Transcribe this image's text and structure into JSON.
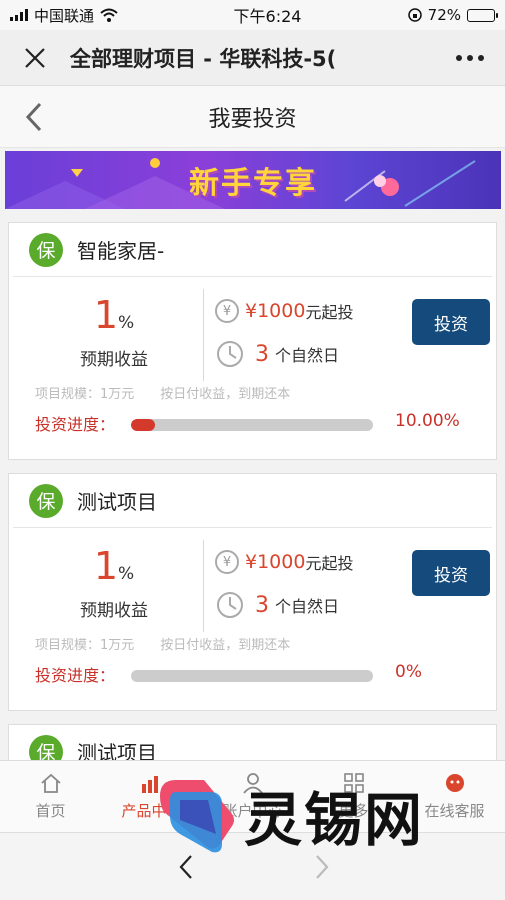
{
  "status": {
    "carrier": "中国联通",
    "time": "下午6:24",
    "battery": "72%"
  },
  "wechat": {
    "title": "全部理财项目 - 华联科技-5("
  },
  "page": {
    "title": "我要投资"
  },
  "banner": {
    "text": "新手专享"
  },
  "products": [
    {
      "badge": "保",
      "name": "智能家居-",
      "rate_value": "1",
      "rate_unit": "%",
      "rate_label": "预期收益",
      "yen": "¥",
      "amount": "¥1000",
      "amount_unit": "元起投",
      "days": "3",
      "days_unit": "个自然日",
      "invest_label": "投资",
      "scale_text": "项目规模：1万元",
      "repay_text": "按日付收益，到期还本",
      "progress_label": "投资进度：",
      "progress": 10.0,
      "progress_text": "10.00%"
    },
    {
      "badge": "保",
      "name": "测试项目",
      "rate_value": "1",
      "rate_unit": "%",
      "rate_label": "预期收益",
      "yen": "¥",
      "amount": "¥1000",
      "amount_unit": "元起投",
      "days": "3",
      "days_unit": "个自然日",
      "invest_label": "投资",
      "scale_text": "项目规模：1万元",
      "repay_text": "按日付收益，到期还本",
      "progress_label": "投资进度：",
      "progress": 0,
      "progress_text": "0%"
    },
    {
      "badge": "保",
      "name": "测试项目"
    }
  ],
  "tabs": [
    {
      "label": "首页",
      "icon": "home-icon"
    },
    {
      "label": "产品中心",
      "icon": "chart-icon"
    },
    {
      "label": "账户中心",
      "icon": "user-icon"
    },
    {
      "label": "更多",
      "icon": "grid-icon"
    },
    {
      "label": "在线客服",
      "icon": "service-icon"
    }
  ],
  "watermark": {
    "text": "灵锡网"
  },
  "colors": {
    "accent": "#d9462d",
    "button": "#154a7c",
    "badge": "#5aaa2c"
  }
}
